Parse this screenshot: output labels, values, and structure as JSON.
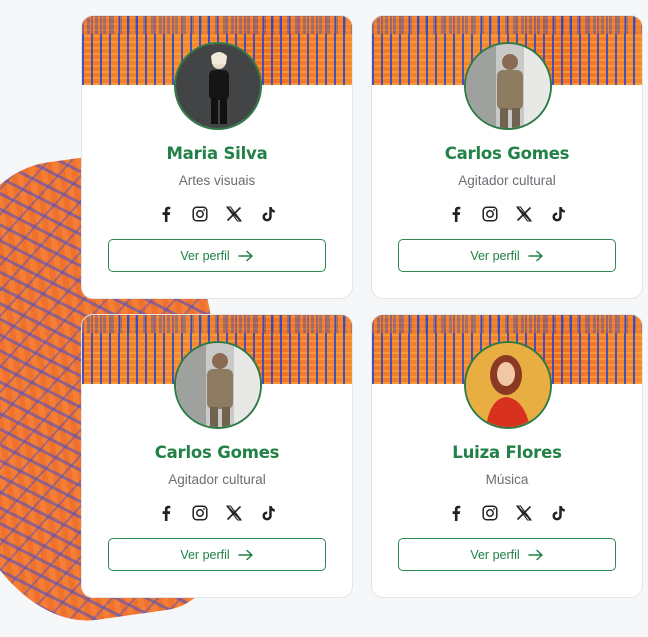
{
  "cards": [
    {
      "name": "Maria Silva",
      "role": "Artes visuais",
      "button_label": "Ver perfil",
      "avatar": "person-in-dark-outfit"
    },
    {
      "name": "Carlos Gomes",
      "role": "Agitador cultural",
      "button_label": "Ver perfil",
      "avatar": "man-in-beige-jacket"
    },
    {
      "name": "Carlos Gomes",
      "role": "Agitador cultural",
      "button_label": "Ver perfil",
      "avatar": "man-in-beige-jacket"
    },
    {
      "name": "Luiza Flores",
      "role": "Música",
      "button_label": "Ver perfil",
      "avatar": "woman-in-red-top"
    }
  ],
  "social_icons": [
    "facebook-icon",
    "instagram-icon",
    "x-icon",
    "tiktok-icon"
  ],
  "colors": {
    "accent_green": "#218146",
    "role_gray": "#6b6e73",
    "banner_orange": "#f07a2a",
    "banner_blue": "#2846d2",
    "page_bg": "#f6f7f9"
  }
}
